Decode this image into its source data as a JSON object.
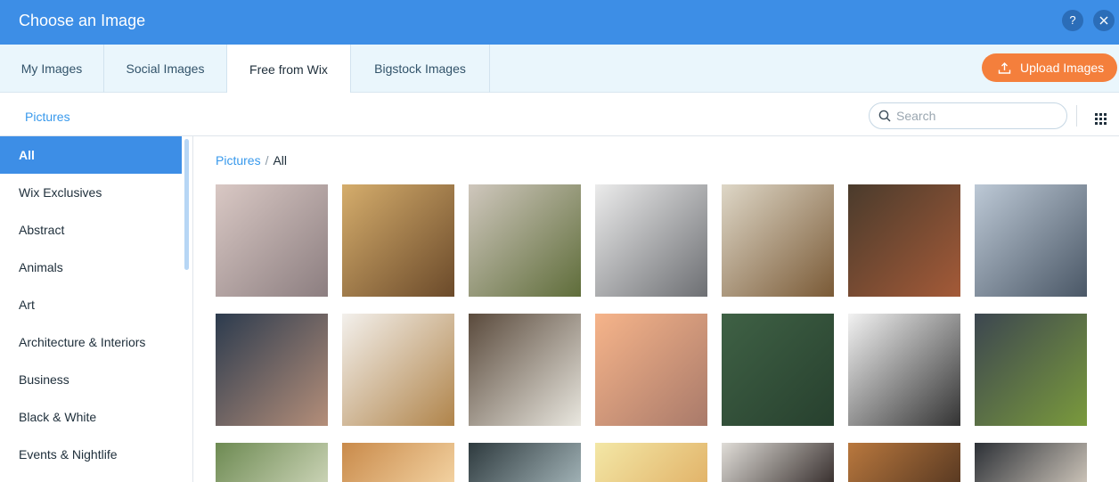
{
  "dialog": {
    "title": "Choose an Image",
    "help_label": "?",
    "close_label": "×"
  },
  "tabs": [
    {
      "label": "My Images"
    },
    {
      "label": "Social Images"
    },
    {
      "label": "Free from Wix"
    },
    {
      "label": "Bigstock Images"
    }
  ],
  "active_tab": "Free from Wix",
  "upload": {
    "label": "Upload Images",
    "icon": "upload-icon"
  },
  "toolbar": {
    "section_label": "Pictures",
    "search_placeholder": "Search",
    "view_icon": "grid-view-icon"
  },
  "sidebar": {
    "items": [
      {
        "label": "All"
      },
      {
        "label": "Wix Exclusives"
      },
      {
        "label": "Abstract"
      },
      {
        "label": "Animals"
      },
      {
        "label": "Art"
      },
      {
        "label": "Architecture & Interiors"
      },
      {
        "label": "Business"
      },
      {
        "label": "Black & White"
      },
      {
        "label": "Events & Nightlife"
      }
    ],
    "selected": "All"
  },
  "breadcrumb": {
    "root": "Pictures",
    "separator": "/",
    "current": "All"
  },
  "colors": {
    "header": "#3d8ee6",
    "accent": "#3899ec",
    "upload": "#f47f3c",
    "tab_bar": "#eaf6fc"
  },
  "gallery": [
    {
      "subject": "laptop-keyboard-hands",
      "colors": [
        "#d9c8c4",
        "#8c7e80"
      ]
    },
    {
      "subject": "books-on-shelf",
      "colors": [
        "#d5ad6c",
        "#6b4a2a"
      ]
    },
    {
      "subject": "cooking-eggs-asparagus",
      "colors": [
        "#cfc7bd",
        "#5f6d3a"
      ]
    },
    {
      "subject": "paint-bottles",
      "colors": [
        "#ebebeb",
        "#6d6f73"
      ]
    },
    {
      "subject": "field-notes-map",
      "colors": [
        "#ded7c7",
        "#7a5a36"
      ]
    },
    {
      "subject": "vintage-camera",
      "colors": [
        "#4a3b2c",
        "#a45a38"
      ]
    },
    {
      "subject": "hand-writing-charts",
      "colors": [
        "#bdc9d6",
        "#4a5766"
      ]
    },
    {
      "subject": "clasped-hands",
      "colors": [
        "#2c3b4e",
        "#b48e79"
      ]
    },
    {
      "subject": "granola-blueberries",
      "colors": [
        "#f3f0ec",
        "#b0844a"
      ]
    },
    {
      "subject": "flowers-on-wood",
      "colors": [
        "#5a4a3c",
        "#e9e7df"
      ]
    },
    {
      "subject": "pink-petals",
      "colors": [
        "#f6b48a",
        "#a97a6a"
      ]
    },
    {
      "subject": "forest-aerial",
      "colors": [
        "#3f6145",
        "#27402e"
      ]
    },
    {
      "subject": "typography-g",
      "colors": [
        "#f2f2f2",
        "#333333"
      ]
    },
    {
      "subject": "tea-leaves",
      "colors": [
        "#3c4650",
        "#7a9a3c"
      ]
    },
    {
      "subject": "park-trees",
      "colors": [
        "#6d8a52",
        "#c9d2b4"
      ]
    },
    {
      "subject": "friends-bokeh",
      "colors": [
        "#c98a4a",
        "#f2d1a0"
      ]
    },
    {
      "subject": "window-view",
      "colors": [
        "#2e3a3e",
        "#9fb0b4"
      ]
    },
    {
      "subject": "yellow-room",
      "colors": [
        "#f3e7a6",
        "#e2b46a"
      ]
    },
    {
      "subject": "people-office",
      "colors": [
        "#e0ddd8",
        "#3a3230"
      ]
    },
    {
      "subject": "wood-logs",
      "colors": [
        "#b9783e",
        "#5a3a22"
      ]
    },
    {
      "subject": "city-lights",
      "colors": [
        "#2c3036",
        "#c9c1b6"
      ]
    }
  ]
}
